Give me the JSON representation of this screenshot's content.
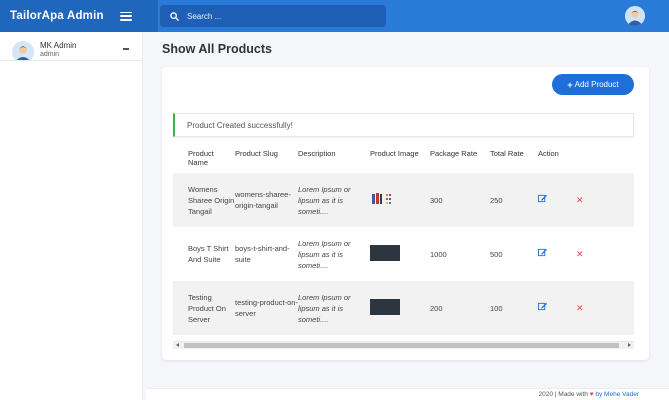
{
  "brand": {
    "title": "TailorApa Admin"
  },
  "search": {
    "placeholder": "Search ..."
  },
  "sidebar": {
    "user_name": "MK Admin",
    "user_role": "admin"
  },
  "page": {
    "title": "Show All Products"
  },
  "card": {
    "add_button_label": "Add Product",
    "alert_text": "Product Created successfully!"
  },
  "table": {
    "headers": [
      "Product Name",
      "Product Slug",
      "Description",
      "Product Image",
      "Package Rate",
      "Total Rate",
      "Action",
      ""
    ],
    "rows": [
      {
        "name": "Womens Sharee Origin Tangail",
        "slug": "womens-sharee-origin-tangail",
        "description": "Lorem Ipsum or lipsum as it is someti....",
        "image": "multi-color-thumbnail",
        "package_rate": "300",
        "total_rate": "250"
      },
      {
        "name": "Boys T Shirt And Suite",
        "slug": "boys-t-shirt-and-suite",
        "description": "Lorem Ipsum or lipsum as it is someti....",
        "image": "dark-thumbnail",
        "package_rate": "1000",
        "total_rate": "500"
      },
      {
        "name": "Testing Product On Server",
        "slug": "testing-product-on-server",
        "description": "Lorem Ipsum or lipsum as it is someti....",
        "image": "dark-thumbnail",
        "package_rate": "200",
        "total_rate": "100"
      }
    ]
  },
  "footer": {
    "text": "2020 | Made with",
    "author": "by Mehe Vader"
  },
  "colors": {
    "primary": "#2a7ad8",
    "brand_bg": "#1f66bd",
    "success": "#3bb54a",
    "danger": "#e0474c"
  }
}
